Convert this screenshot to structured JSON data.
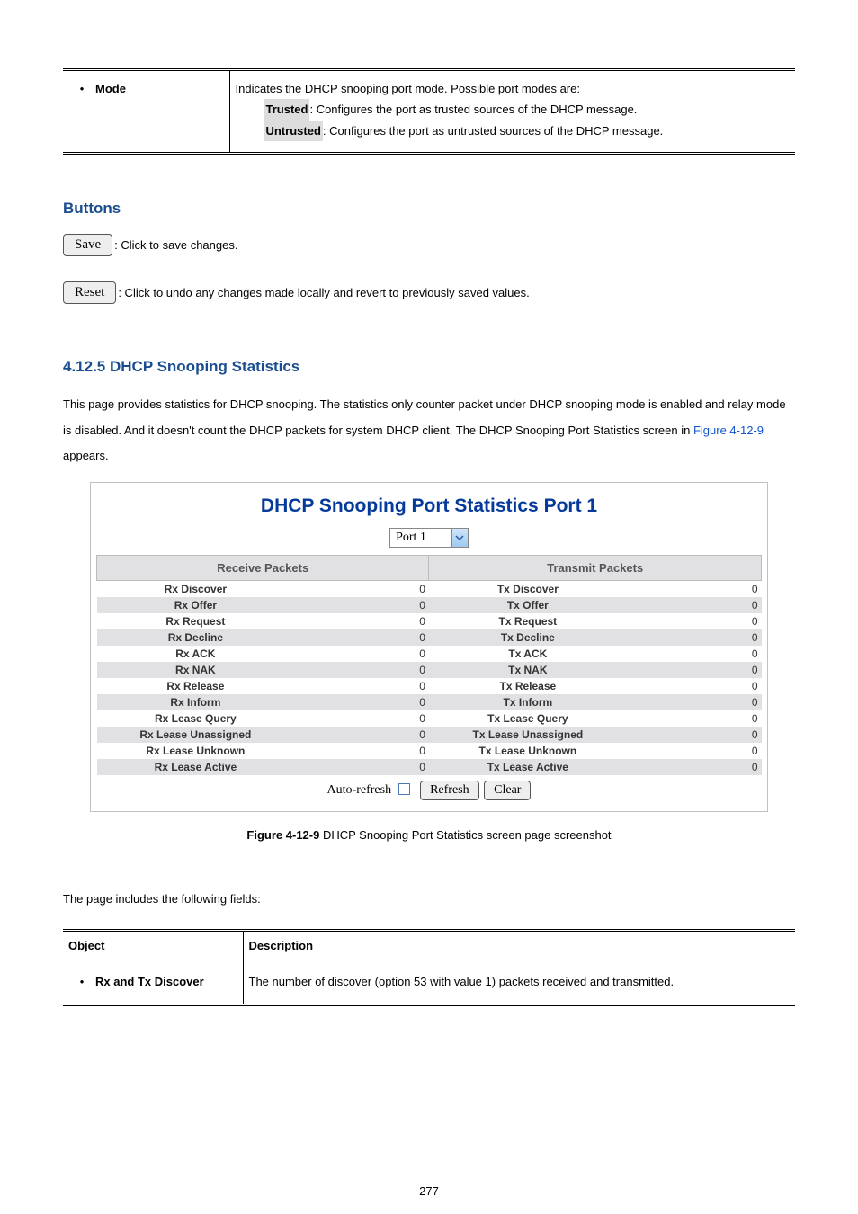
{
  "table1": {
    "obj_label": "Mode",
    "desc_line1": "Indicates the DHCP snooping port mode. Possible port modes are:",
    "sub1_label": "Trusted",
    "sub1_text": ": Configures the port as trusted sources of the DHCP message.",
    "sub2_label": "Untrusted",
    "sub2_text": ": Configures the port as untrusted sources of the DHCP message."
  },
  "buttons_heading": "Buttons",
  "save_label": "Save",
  "save_text": ": Click to save changes.",
  "reset_label": "Reset",
  "reset_text": ": Click to undo any changes made locally and revert to previously saved values.",
  "section_heading": "4.12.5 DHCP Snooping Statistics",
  "intro": {
    "part1": "This page provides statistics for DHCP snooping. The statistics only counter packet under DHCP snooping mode is enabled and relay mode is disabled. And it doesn't count the DHCP packets for system DHCP client. The DHCP Snooping Port Statistics screen in ",
    "figure_link": "Figure 4-12-9",
    "part2": " appears."
  },
  "screenshot": {
    "title": "DHCP Snooping Port Statistics  Port 1",
    "port_label": "Port 1",
    "receive_header": "Receive Packets",
    "transmit_header": "Transmit Packets",
    "rows": [
      {
        "rx_label": "Rx Discover",
        "rx_val": "0",
        "tx_label": "Tx Discover",
        "tx_val": "0"
      },
      {
        "rx_label": "Rx Offer",
        "rx_val": "0",
        "tx_label": "Tx Offer",
        "tx_val": "0"
      },
      {
        "rx_label": "Rx Request",
        "rx_val": "0",
        "tx_label": "Tx Request",
        "tx_val": "0"
      },
      {
        "rx_label": "Rx Decline",
        "rx_val": "0",
        "tx_label": "Tx Decline",
        "tx_val": "0"
      },
      {
        "rx_label": "Rx ACK",
        "rx_val": "0",
        "tx_label": "Tx ACK",
        "tx_val": "0"
      },
      {
        "rx_label": "Rx NAK",
        "rx_val": "0",
        "tx_label": "Tx NAK",
        "tx_val": "0"
      },
      {
        "rx_label": "Rx Release",
        "rx_val": "0",
        "tx_label": "Tx Release",
        "tx_val": "0"
      },
      {
        "rx_label": "Rx Inform",
        "rx_val": "0",
        "tx_label": "Tx Inform",
        "tx_val": "0"
      },
      {
        "rx_label": "Rx Lease Query",
        "rx_val": "0",
        "tx_label": "Tx Lease Query",
        "tx_val": "0"
      },
      {
        "rx_label": "Rx Lease Unassigned",
        "rx_val": "0",
        "tx_label": "Tx Lease Unassigned",
        "tx_val": "0"
      },
      {
        "rx_label": "Rx Lease Unknown",
        "rx_val": "0",
        "tx_label": "Tx Lease Unknown",
        "tx_val": "0"
      },
      {
        "rx_label": "Rx Lease Active",
        "rx_val": "0",
        "tx_label": "Tx Lease Active",
        "tx_val": "0"
      }
    ],
    "auto_refresh_label": "Auto-refresh",
    "refresh_button": "Refresh",
    "clear_button": "Clear"
  },
  "caption_prefix": "Figure 4-12-9 ",
  "caption": "DHCP Snooping Port Statistics screen page screenshot",
  "fields_intro": "The page includes the following fields:",
  "table2": {
    "obj_header": "Object",
    "desc_header": "Description",
    "obj1": "Rx and Tx Discover",
    "desc1": "The number of discover (option 53 with value 1) packets received and transmitted."
  },
  "page_num": "277"
}
